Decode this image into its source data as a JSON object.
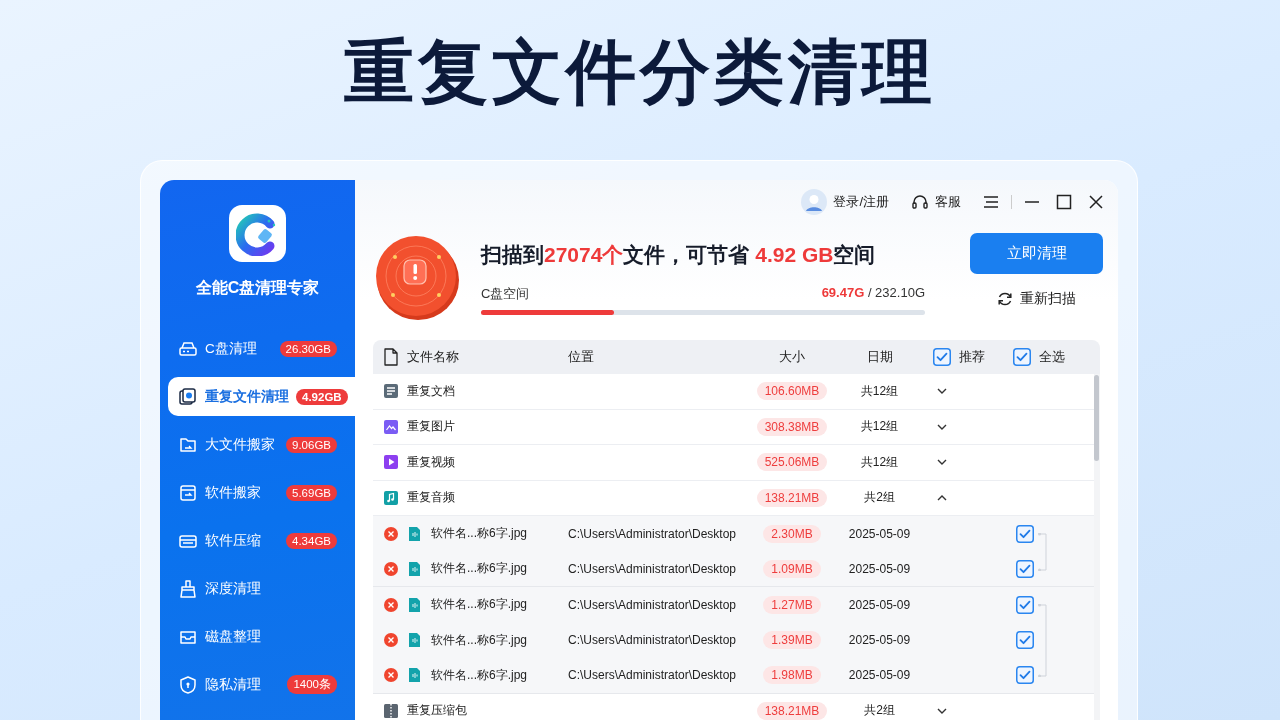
{
  "headline": "重复文件分类清理",
  "app": {
    "name": "全能C盘清理专家"
  },
  "sidebar": {
    "items": [
      {
        "label": "C盘清理",
        "badge": "26.30GB",
        "selected": false
      },
      {
        "label": "重复文件清理",
        "badge": "4.92GB",
        "selected": true
      },
      {
        "label": "大文件搬家",
        "badge": "9.06GB",
        "selected": false
      },
      {
        "label": "软件搬家",
        "badge": "5.69GB",
        "selected": false
      },
      {
        "label": "软件压缩",
        "badge": "4.34GB",
        "selected": false
      },
      {
        "label": "深度清理",
        "selected": false
      },
      {
        "label": "磁盘整理",
        "selected": false
      },
      {
        "label": "隐私清理",
        "badge": "1400条",
        "selected": false
      }
    ]
  },
  "titlebar": {
    "login": "登录/注册",
    "service": "客服"
  },
  "summary": {
    "headline": [
      {
        "text": "扫描到",
        "highlight": false
      },
      {
        "text": "27074个",
        "highlight": true
      },
      {
        "text": "文件，可节省 ",
        "highlight": false
      },
      {
        "text": "4.92 GB",
        "highlight": true
      },
      {
        "text": "空间",
        "highlight": false
      }
    ],
    "disk_label": "C盘空间",
    "used": "69.47G",
    "total": "/ 232.10G",
    "level": 0.3,
    "clean_button": "立即清理",
    "rescan": "重新扫描"
  },
  "table": {
    "columns": [
      {
        "label": "文件名称"
      },
      {
        "label": "位置"
      },
      {
        "label": "大小"
      },
      {
        "label": "日期"
      },
      {
        "label": "推荐",
        "checked": true
      },
      {
        "label": "全选",
        "checked": true
      }
    ],
    "rows": [
      {
        "kind": "document",
        "name": "重复文档",
        "size": "106.60MB",
        "count": "共12组",
        "expanded": false
      },
      {
        "kind": "image",
        "name": "重复图片",
        "size": "308.38MB",
        "count": "共12组",
        "expanded": false
      },
      {
        "kind": "video",
        "name": "重复视频",
        "size": "525.06MB",
        "count": "共12组",
        "expanded": false
      },
      {
        "kind": "audio",
        "name": "重复音频",
        "size": "138.21MB",
        "count": "共2组",
        "expanded": true,
        "groups": [
          {
            "files": [
              {
                "name": "软件名...称6字.jpg",
                "path": "C:\\Users\\Administrator\\Desktop",
                "size": "2.30MB",
                "date": "2025-05-09",
                "checked": true
              },
              {
                "name": "软件名...称6字.jpg",
                "path": "C:\\Users\\Administrator\\Desktop",
                "size": "1.09MB",
                "date": "2025-05-09",
                "checked": true
              }
            ]
          },
          {
            "files": [
              {
                "name": "软件名...称6字.jpg",
                "path": "C:\\Users\\Administrator\\Desktop",
                "size": "1.27MB",
                "date": "2025-05-09",
                "checked": true
              },
              {
                "name": "软件名...称6字.jpg",
                "path": "C:\\Users\\Administrator\\Desktop",
                "size": "1.39MB",
                "date": "2025-05-09",
                "checked": true
              },
              {
                "name": "软件名...称6字.jpg",
                "path": "C:\\Users\\Administrator\\Desktop",
                "size": "1.98MB",
                "date": "2025-05-09",
                "checked": true
              }
            ]
          }
        ]
      },
      {
        "kind": "archive",
        "name": "重复压缩包",
        "size": "138.21MB",
        "count": "共2组",
        "expanded": false
      }
    ]
  }
}
